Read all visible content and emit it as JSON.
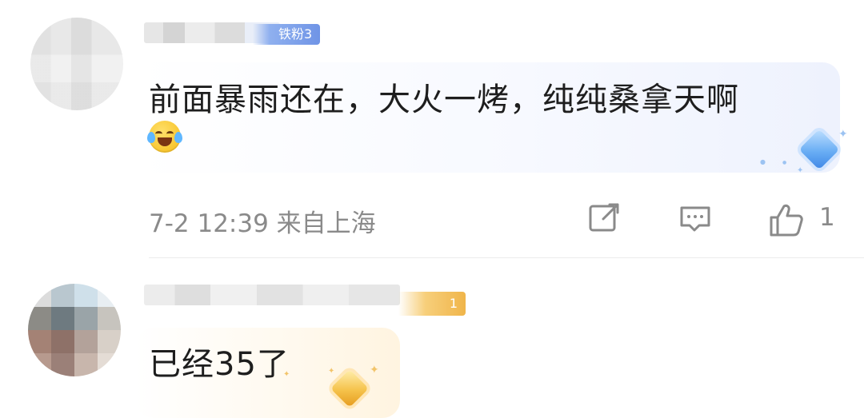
{
  "comments": [
    {
      "fan_badge": "铁粉3",
      "text": "前面暴雨还在，大火一烤，纯纯桑拿天啊",
      "emoji": "rofl-emoji",
      "meta": "7-2 12:39  来自上海",
      "like_count": "1",
      "actions": [
        "repost-icon",
        "comment-icon",
        "like-icon"
      ]
    },
    {
      "fan_badge": "1",
      "text": "已经35了"
    }
  ],
  "colors": {
    "badge_blue": "#6f94e6",
    "badge_gold": "#f0b54a",
    "text": "#1e1e1e",
    "meta": "#8a8a8a"
  }
}
